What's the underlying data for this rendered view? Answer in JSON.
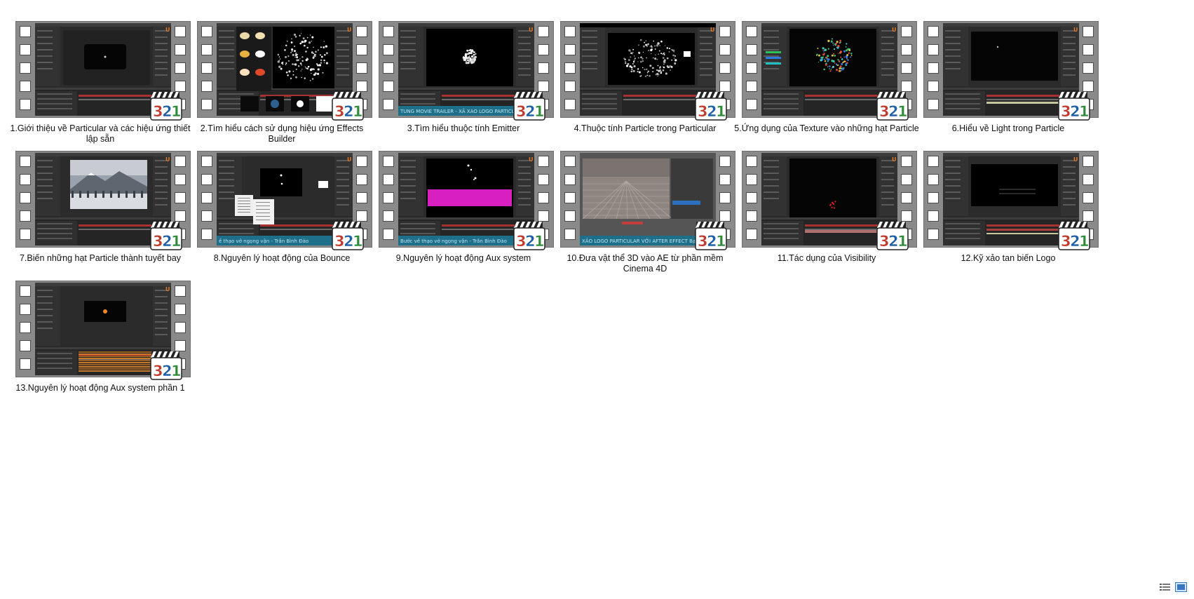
{
  "items": [
    {
      "label": "1.Giới thiệu về Particular và các hiệu ứng thiết lập sẵn",
      "thumb": "ae-composition-dark"
    },
    {
      "label": "2.Tìm hiểu cách sử dụng hiệu ứng Effects Builder",
      "thumb": "effects-builder-particles"
    },
    {
      "label": "3.Tìm hiểu thuộc tính Emitter",
      "thumb": "emitter-burst",
      "banner": "TUNG MOVIE TRAILER - XẢ XAO LOGO PARTICULAR VỚI AFTE"
    },
    {
      "label": "4.Thuộc tính Particle trong Particular",
      "thumb": "particle-scatter"
    },
    {
      "label": "5.Ứng dụng của Texture vào những hạt Particle",
      "thumb": "textured-particles"
    },
    {
      "label": "6.Hiểu về Light trong Particle",
      "thumb": "light-dark-comp"
    },
    {
      "label": "7.Biến những hạt Particle thành tuyết bay",
      "thumb": "snow-landscape"
    },
    {
      "label": "8.Nguyên lý hoạt động của Bounce",
      "thumb": "bounce-menu",
      "banner": "ề thạo vở ngọng vận - Trần Bình Đào"
    },
    {
      "label": "9.Nguyên lý hoạt động Aux system",
      "thumb": "aux-magenta",
      "banner": "Bước về thạo vở ngọng vận - Trần Bình Đào"
    },
    {
      "label": "10.Đưa vật thể 3D vào AE từ phần mềm Cinema 4D",
      "thumb": "cinema4d-floor",
      "banner": "XẢO LOGO PARTICULAR VỚI AFTER EFFECT Bạn tuyệt thực"
    },
    {
      "label": "11.Tác dụng của Visibility",
      "thumb": "visibility-red"
    },
    {
      "label": "12.Kỹ xảo tan biến Logo",
      "thumb": "logo-dissolve"
    },
    {
      "label": "13.Nguyên lý hoạt động Aux system phần 1",
      "thumb": "aux-timeline-orange"
    }
  ],
  "badge_text": "321",
  "badge_colors": {
    "three": "#c0392b",
    "two": "#1f5fa8",
    "one": "#2e8b3a",
    "clapper": "#222222"
  },
  "icons": {
    "details_view": "details-view-icon",
    "large_icons_view": "large-icons-view-icon"
  }
}
